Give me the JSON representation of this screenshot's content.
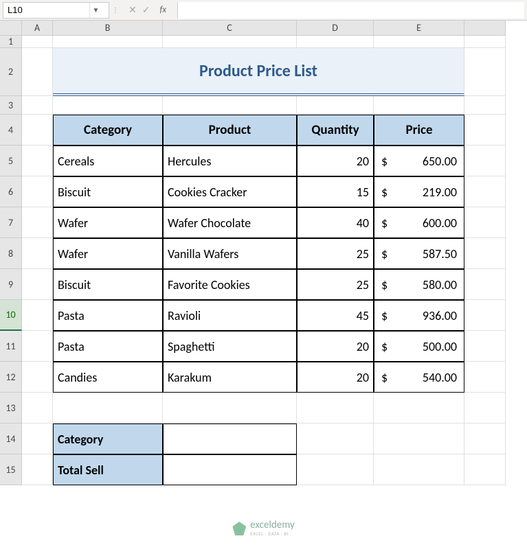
{
  "formula_bar": {
    "cell_ref": "L10",
    "cancel": "✕",
    "confirm": "✓",
    "fx": "fx",
    "formula": ""
  },
  "columns": [
    "A",
    "B",
    "C",
    "D",
    "E"
  ],
  "rows": [
    "1",
    "2",
    "3",
    "4",
    "5",
    "6",
    "7",
    "8",
    "9",
    "10",
    "11",
    "12",
    "13",
    "14",
    "15"
  ],
  "title": "Product Price List",
  "headers": {
    "category": "Category",
    "product": "Product",
    "quantity": "Quantity",
    "price": "Price"
  },
  "table": [
    {
      "category": "Cereals",
      "product": "Hercules",
      "quantity": "20",
      "price": "650.00"
    },
    {
      "category": "Biscuit",
      "product": "Cookies Cracker",
      "quantity": "15",
      "price": "219.00"
    },
    {
      "category": "Wafer",
      "product": "Wafer Chocolate",
      "quantity": "40",
      "price": "600.00"
    },
    {
      "category": "Wafer",
      "product": "Vanilla Wafers",
      "quantity": "25",
      "price": "587.50"
    },
    {
      "category": "Biscuit",
      "product": "Favorite Cookies",
      "quantity": "25",
      "price": "580.00"
    },
    {
      "category": "Pasta",
      "product": "Ravioli",
      "quantity": "45",
      "price": "936.00"
    },
    {
      "category": "Pasta",
      "product": "Spaghetti",
      "quantity": "20",
      "price": "500.00"
    },
    {
      "category": "Candies",
      "product": "Karakum",
      "quantity": "20",
      "price": "540.00"
    }
  ],
  "currency": "$",
  "summary": {
    "category_label": "Category",
    "category_value": "",
    "total_label": "Total Sell",
    "total_value": ""
  },
  "watermark": {
    "name": "exceldemy",
    "sub": "EXCEL · DATA · BI"
  }
}
